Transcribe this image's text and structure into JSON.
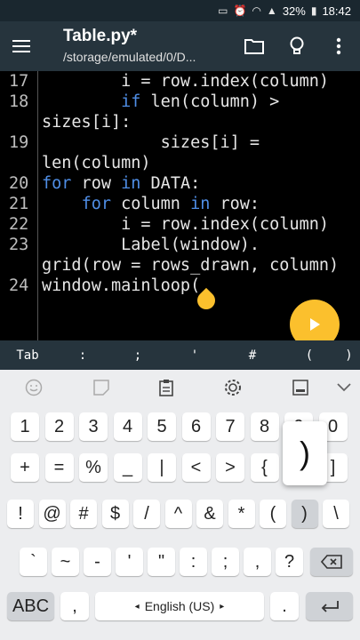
{
  "status_bar": {
    "battery": "32%",
    "time": "18:42"
  },
  "app_bar": {
    "title": "Table.py*",
    "subtitle": "/storage/emulated/0/D..."
  },
  "editor": {
    "lines": [
      {
        "num": "17",
        "indent": "        ",
        "parts": [
          {
            "t": "i = row.index(column)",
            "k": false
          }
        ]
      },
      {
        "num": "18",
        "indent": "        ",
        "parts": [
          {
            "t": "if",
            "k": true
          },
          {
            "t": " len(column) >",
            "k": false
          }
        ]
      },
      {
        "num": "",
        "indent": "",
        "parts": [
          {
            "t": "sizes[i]:",
            "k": false
          }
        ]
      },
      {
        "num": "19",
        "indent": "            ",
        "parts": [
          {
            "t": "sizes[i] =",
            "k": false
          }
        ]
      },
      {
        "num": "",
        "indent": "",
        "parts": [
          {
            "t": "len(column)",
            "k": false
          }
        ]
      },
      {
        "num": "20",
        "indent": "",
        "parts": [
          {
            "t": "for",
            "k": true
          },
          {
            "t": " row ",
            "k": false
          },
          {
            "t": "in",
            "k": true
          },
          {
            "t": " DATA:",
            "k": false
          }
        ]
      },
      {
        "num": "21",
        "indent": "    ",
        "parts": [
          {
            "t": "for",
            "k": true
          },
          {
            "t": " column ",
            "k": false
          },
          {
            "t": "in",
            "k": true
          },
          {
            "t": " row:",
            "k": false
          }
        ]
      },
      {
        "num": "22",
        "indent": "        ",
        "parts": [
          {
            "t": "i = row.index(column)",
            "k": false
          }
        ]
      },
      {
        "num": "23",
        "indent": "        ",
        "parts": [
          {
            "t": "Label(window).",
            "k": false
          }
        ]
      },
      {
        "num": "",
        "indent": "",
        "parts": [
          {
            "t": "grid(row = rows_drawn, column)",
            "k": false
          }
        ]
      },
      {
        "num": "24",
        "indent": "",
        "parts": [
          {
            "t": "window.mainloop(",
            "k": false
          }
        ]
      }
    ]
  },
  "symbol_bar": [
    "Tab",
    ":",
    ";",
    "'",
    "#",
    "(",
    ")"
  ],
  "keyboard": {
    "row1": [
      "1",
      "2",
      "3",
      "4",
      "5",
      "6",
      "7",
      "8",
      "9",
      "0"
    ],
    "row2": [
      "+",
      "=",
      "%",
      "_",
      "|",
      "<",
      ">",
      "{",
      "}",
      "]"
    ],
    "row3": [
      "!",
      "@",
      "#",
      "$",
      "/",
      "^",
      "&",
      "*",
      "(",
      ")",
      "\\"
    ],
    "row4": [
      "`",
      "~",
      "-",
      "'",
      "\"",
      ":",
      ";",
      ",",
      "?"
    ],
    "abc_label": "ABC",
    "comma": ",",
    "space_label": "English (US)",
    "period": ".",
    "popup_char": ")"
  },
  "colors": {
    "accent": "#fbc02d",
    "keyword": "#4f8ee6",
    "appbar": "#26343d"
  }
}
